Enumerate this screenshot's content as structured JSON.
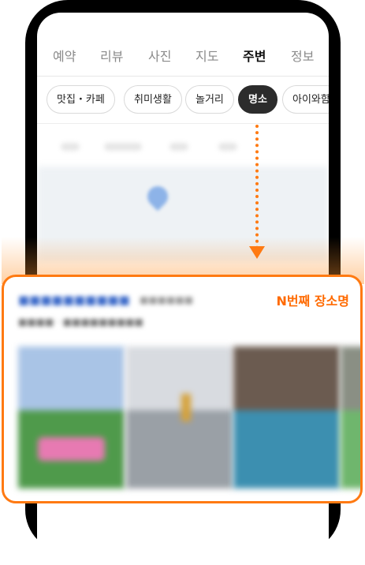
{
  "tabs": [
    {
      "label": "예약",
      "active": false
    },
    {
      "label": "리뷰",
      "active": false
    },
    {
      "label": "사진",
      "active": false
    },
    {
      "label": "지도",
      "active": false
    },
    {
      "label": "주변",
      "active": true
    },
    {
      "label": "정보",
      "active": false
    }
  ],
  "chips": [
    {
      "label": "맛집・카페",
      "active": false
    },
    {
      "label": "취미생활",
      "active": false
    },
    {
      "label": "놀거리",
      "active": false
    },
    {
      "label": "명소",
      "active": true
    },
    {
      "label": "아이와함",
      "active": false
    }
  ],
  "highlight": {
    "label": "N번째 장소명"
  },
  "colors": {
    "accent": "#ff7a12",
    "active_chip": "#2c2c2c",
    "phone_frame": "#000000"
  },
  "icons": [
    "map-pin-icon",
    "arrow-down-icon"
  ]
}
